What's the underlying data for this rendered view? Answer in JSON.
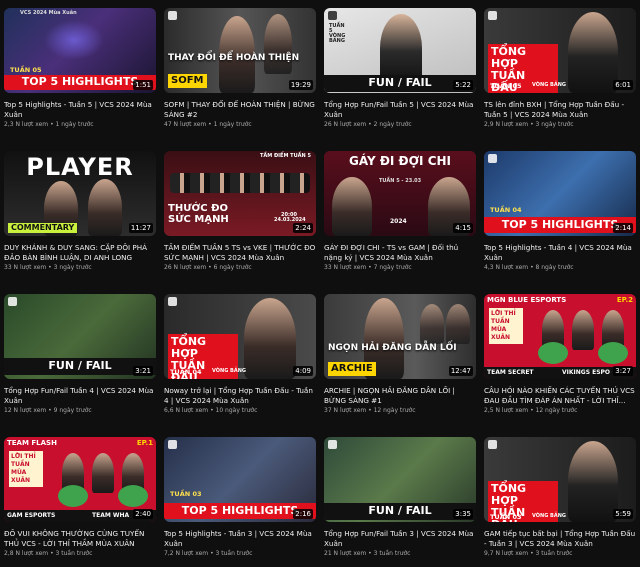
{
  "videos": [
    {
      "title": "Top 5 Highlights - Tuần 5 | VCS 2024 Mùa Xuân",
      "views": "2,3 N lượt xem",
      "age": "1 ngày trước",
      "duration": "1:51",
      "overlay": "TOP 5 HIGHLIGHTS",
      "sub": "TUẦN 05",
      "hdr": "VCS 2024 Mùa Xuân"
    },
    {
      "title": "SOFM | THAY ĐỔI ĐỂ HOÀN THIỆN | BỪNG SÁNG #2",
      "views": "47 N lượt xem",
      "age": "1 ngày trước",
      "duration": "19:29",
      "overlay": "THAY ĐỔI ĐỂ HOÀN THIỆN",
      "sub": "SOFM"
    },
    {
      "title": "Tổng Hợp Fun/Fail Tuần 5 | VCS 2024 Mùa Xuân",
      "views": "26 N lượt xem",
      "age": "2 ngày trước",
      "duration": "5:22",
      "overlay": "FUN / FAIL",
      "sub": "TUẦN 5 VÒNG BẢNG"
    },
    {
      "title": "TS lên đỉnh BXH | Tổng Hợp Tuần Đấu - Tuần 5 | VCS 2024 Mùa Xuân",
      "views": "2,9 N lượt xem",
      "age": "3 ngày trước",
      "duration": "6:01",
      "overlay": "TỔNG HỢP TUẦN ĐẤU",
      "sub": "TUẦN 05",
      "sub2": "VÒNG BẢNG"
    },
    {
      "title": "DUY KHÁNH & DUY SANG: CẶP ĐÔI PHÁ ĐẢO BÀN BÌNH LUẬN, DI ANH LONG CUA...",
      "views": "33 N lượt xem",
      "age": "3 ngày trước",
      "duration": "11:27",
      "overlay": "PLAYER",
      "sub": "COMMENTARY"
    },
    {
      "title": "TẦM ĐIỂM TUẦN 5 TS vs VKE | THƯỚC ĐO SỨC MẠNH | VCS 2024 Mùa Xuân",
      "views": "26 N lượt xem",
      "age": "6 ngày trước",
      "duration": "2:24",
      "overlay": "THƯỚC ĐO SỨC MẠNH",
      "sub": "TẦM ĐIỂM TUẦN 5",
      "sub2": "20:00 24.03.2024"
    },
    {
      "title": "GÁY ĐI ĐỢI CHI - TS vs GAM | Đối thủ nặng ký | VCS 2024 Mùa Xuân",
      "views": "33 N lượt xem",
      "age": "7 ngày trước",
      "duration": "4:15",
      "overlay": "GÁY ĐI ĐỢI CHI",
      "sub": "TUẦN 5 - 23.03",
      "sub2": "2024"
    },
    {
      "title": "Top 5 Highlights - Tuần 4 | VCS 2024 Mùa Xuân",
      "views": "4,3 N lượt xem",
      "age": "8 ngày trước",
      "duration": "2:14",
      "overlay": "TOP 5 HIGHLIGHTS",
      "sub": "TUẦN 04"
    },
    {
      "title": "Tổng Hợp Fun/Fail Tuần 4 | VCS 2024 Mùa Xuân",
      "views": "12 N lượt xem",
      "age": "9 ngày trước",
      "duration": "3:21",
      "overlay": "FUN / FAIL"
    },
    {
      "title": "Noway trở lại | Tổng Hợp Tuần Đấu - Tuần 4 | VCS 2024 Mùa Xuân",
      "views": "6,6 N lượt xem",
      "age": "10 ngày trước",
      "duration": "4:09",
      "overlay": "TỔNG HỢP TUẦN ĐẤU",
      "sub": "TUẦN 04",
      "sub2": "VÒNG BẢNG"
    },
    {
      "title": "ARCHIE | NGỌN HẢI ĐĂNG DẪN LỐI | BỪNG SÁNG #1",
      "views": "37 N lượt xem",
      "age": "12 ngày trước",
      "duration": "12:47",
      "overlay": "NGỌN HẢI ĐĂNG DẪN LỐI",
      "sub": "ARCHIE"
    },
    {
      "title": "CÂU HỎI NÀO KHIẾN CÁC TUYỂN THỦ VCS ĐAU ĐẦU TÌM ĐÁP ÁN NHẤT - LỜI THỈ...",
      "views": "2,5 N lượt xem",
      "age": "12 ngày trước",
      "duration": "3:27",
      "overlay": "MGN BLUE ESPORTS",
      "sub": "EP.2",
      "sub2": "TEAM SECRET",
      "sub3": "VIKINGS ESPO",
      "stamp": "LỜI THỈ TUẦN MÙA XUÂN"
    },
    {
      "title": "ĐỒ VUI KHÔNG THƯỜNG CÙNG TUYỂN THỦ VCS - LỜI THỈ THẦM MÙA XUÂN",
      "views": "2,8 N lượt xem",
      "age": "3 tuần trước",
      "duration": "2:40",
      "overlay": "TEAM FLASH",
      "sub": "EP.1",
      "sub2": "GAM ESPORTS",
      "sub3": "TEAM WHA",
      "stamp": "LỜI THỈ TUẦN MÙA XUÂN"
    },
    {
      "title": "Top 5 Highlights - Tuần 3 | VCS 2024 Mùa Xuân",
      "views": "7,2 N lượt xem",
      "age": "3 tuần trước",
      "duration": "2:16",
      "overlay": "TOP 5 HIGHLIGHTS",
      "sub": "TUẦN 03"
    },
    {
      "title": "Tổng Hợp Fun/Fail Tuần 3 | VCS 2024 Mùa Xuân",
      "views": "21 N lượt xem",
      "age": "3 tuần trước",
      "duration": "3:35",
      "overlay": "FUN / FAIL"
    },
    {
      "title": "GAM tiếp tục bất bại | Tổng Hợp Tuần Đấu - Tuần 3 | VCS 2024 Mùa Xuân",
      "views": "9,7 N lượt xem",
      "age": "3 tuần trước",
      "duration": "5:59",
      "overlay": "TỔNG HỢP TUẦN ĐẤU",
      "sub": "TUẦN 03",
      "sub2": "VÒNG BẢNG"
    }
  ],
  "colors": {
    "bg": "#0f0f0f",
    "meta": "#aaaaaa",
    "accent_red": "#e0111c",
    "accent_yellow": "#ffe14d"
  }
}
